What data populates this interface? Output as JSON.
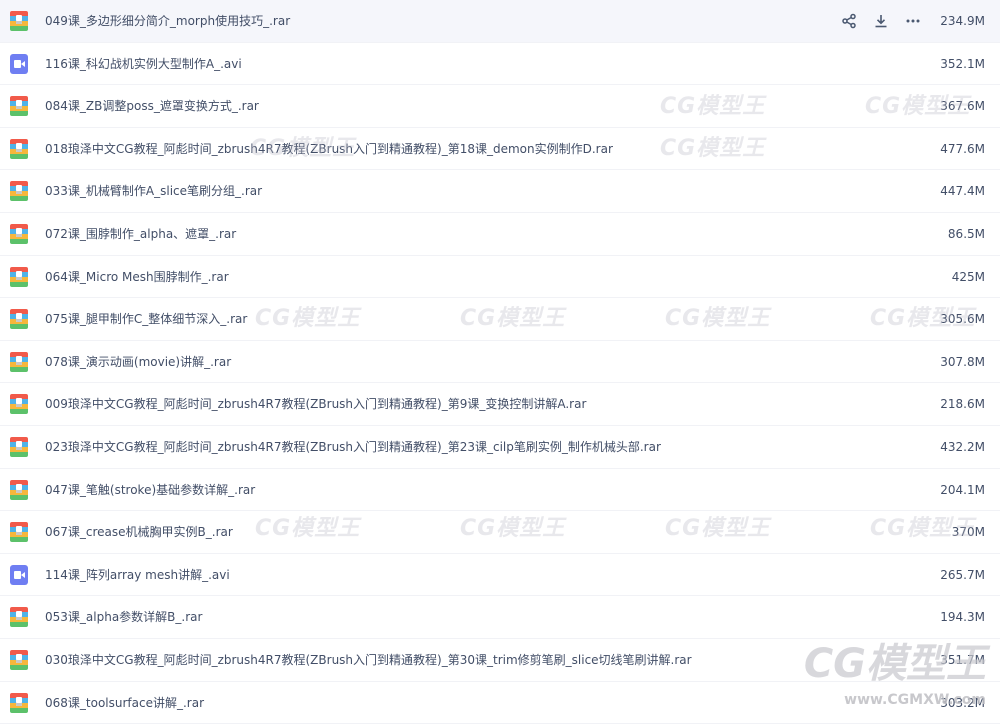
{
  "files": [
    {
      "name": "049课_多边形细分简介_morph使用技巧_.rar",
      "size": "234.9M",
      "type": "rar"
    },
    {
      "name": "116课_科幻战机实例大型制作A_.avi",
      "size": "352.1M",
      "type": "avi"
    },
    {
      "name": "084课_ZB调整poss_遮罩变换方式_.rar",
      "size": "367.6M",
      "type": "rar"
    },
    {
      "name": "018琅泽中文CG教程_阿彪时间_zbrush4R7教程(ZBrush入门到精通教程)_第18课_demon实例制作D.rar",
      "size": "477.6M",
      "type": "rar"
    },
    {
      "name": "033课_机械臂制作A_slice笔刷分组_.rar",
      "size": "447.4M",
      "type": "rar"
    },
    {
      "name": "072课_围脖制作_alpha、遮罩_.rar",
      "size": "86.5M",
      "type": "rar"
    },
    {
      "name": "064课_Micro Mesh围脖制作_.rar",
      "size": "425M",
      "type": "rar"
    },
    {
      "name": "075课_腿甲制作C_整体细节深入_.rar",
      "size": "305.6M",
      "type": "rar"
    },
    {
      "name": "078课_演示动画(movie)讲解_.rar",
      "size": "307.8M",
      "type": "rar"
    },
    {
      "name": "009琅泽中文CG教程_阿彪时间_zbrush4R7教程(ZBrush入门到精通教程)_第9课_变换控制讲解A.rar",
      "size": "218.6M",
      "type": "rar"
    },
    {
      "name": "023琅泽中文CG教程_阿彪时间_zbrush4R7教程(ZBrush入门到精通教程)_第23课_cilp笔刷实例_制作机械头部.rar",
      "size": "432.2M",
      "type": "rar"
    },
    {
      "name": "047课_笔触(stroke)基础参数详解_.rar",
      "size": "204.1M",
      "type": "rar"
    },
    {
      "name": "067课_crease机械胸甲实例B_.rar",
      "size": "370M",
      "type": "rar"
    },
    {
      "name": "114课_阵列array mesh讲解_.avi",
      "size": "265.7M",
      "type": "avi"
    },
    {
      "name": "053课_alpha参数详解B_.rar",
      "size": "194.3M",
      "type": "rar"
    },
    {
      "name": "030琅泽中文CG教程_阿彪时间_zbrush4R7教程(ZBrush入门到精通教程)_第30课_trim修剪笔刷_slice切线笔刷讲解.rar",
      "size": "351.7M",
      "type": "rar"
    },
    {
      "name": "068课_toolsurface讲解_.rar",
      "size": "303.2M",
      "type": "rar"
    }
  ],
  "hovered_index": 0,
  "actions": {
    "share": "share-icon",
    "download": "download-icon",
    "more": "more-icon"
  },
  "watermark": {
    "logo": "CG模型王",
    "url": "www.CGMXW.com"
  },
  "colors": {
    "text": "#424e67",
    "action_icon": "#4a5870",
    "row_hover": "#f5f6fb",
    "avi_icon": "#6f7ef2"
  }
}
